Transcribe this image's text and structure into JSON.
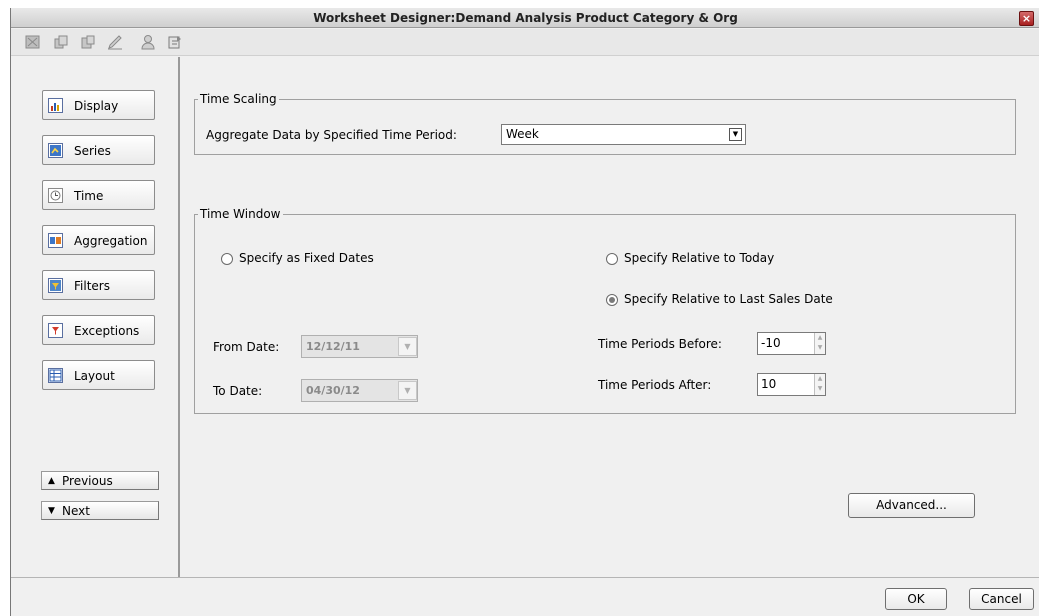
{
  "window": {
    "title": "Worksheet Designer:Demand Analysis Product Category & Org",
    "close_glyph": "×"
  },
  "toolbar": {
    "icons": [
      "open-icon",
      "copy-icon",
      "paste-icon",
      "edit-icon",
      "user-icon",
      "export-icon"
    ]
  },
  "nav": {
    "items": [
      {
        "label": "Display",
        "icon": "chart-icon"
      },
      {
        "label": "Series",
        "icon": "series-icon"
      },
      {
        "label": "Time",
        "icon": "clock-icon"
      },
      {
        "label": "Aggregation",
        "icon": "aggregation-icon"
      },
      {
        "label": "Filters",
        "icon": "filter-icon"
      },
      {
        "label": "Exceptions",
        "icon": "exceptions-icon"
      },
      {
        "label": "Layout",
        "icon": "layout-icon"
      }
    ],
    "previous": "Previous",
    "next": "Next"
  },
  "time_scaling": {
    "legend": "Time Scaling",
    "aggregate_label": "Aggregate Data by Specified Time Period:",
    "aggregate_value": "Week"
  },
  "time_window": {
    "legend": "Time Window",
    "fixed_label": "Specify as Fixed Dates",
    "today_label": "Specify Relative to Today",
    "last_sales_label": "Specify Relative to Last Sales Date",
    "selected": "last_sales",
    "from_label": "From Date:",
    "from_value": "12/12/11",
    "to_label": "To Date:",
    "to_value": "04/30/12",
    "before_label": "Time Periods Before:",
    "before_value": "-10",
    "after_label": "Time Periods After:",
    "after_value": "10"
  },
  "buttons": {
    "advanced": "Advanced...",
    "ok": "OK",
    "cancel": "Cancel"
  }
}
